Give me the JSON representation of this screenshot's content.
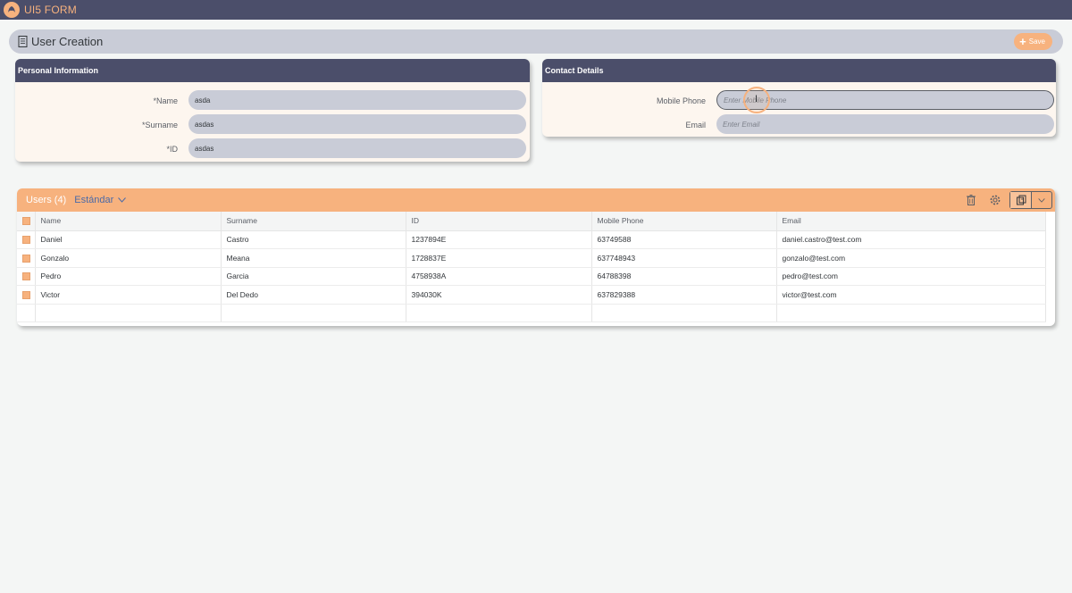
{
  "shell": {
    "title": "UI5 FORM"
  },
  "header": {
    "title": "User Creation",
    "save_label": "Save"
  },
  "personal": {
    "title": "Personal Information",
    "fields": [
      {
        "label": "*Name",
        "value": "asda"
      },
      {
        "label": "*Surname",
        "value": "asdas"
      },
      {
        "label": "*ID",
        "value": "asdas"
      }
    ]
  },
  "contact": {
    "title": "Contact Details",
    "fields": [
      {
        "label": "Mobile Phone",
        "placeholder": "Enter Mobile Phone"
      },
      {
        "label": "Email",
        "placeholder": "Enter Email"
      }
    ]
  },
  "table": {
    "title": "Users (4)",
    "variant": "Estándar",
    "columns": [
      "Name",
      "Surname",
      "ID",
      "Mobile Phone",
      "Email"
    ],
    "rows": [
      [
        "Daniel",
        "Castro",
        "1237894E",
        "63749588",
        "daniel.castro@test.com"
      ],
      [
        "Gonzalo",
        "Meana",
        "1728837E",
        "637748943",
        "gonzalo@test.com"
      ],
      [
        "Pedro",
        "Garcia",
        "4758938A",
        "64788398",
        "pedro@test.com"
      ],
      [
        "Victor",
        "Del Dedo",
        "394030K",
        "637829388",
        "victor@test.com"
      ]
    ],
    "toolbar_icons": [
      "delete-icon",
      "settings-icon",
      "export-icon",
      "chevron-down-icon"
    ]
  },
  "colors": {
    "shell": "#4b4e6a",
    "accent": "#f7b27e",
    "input": "#c9ccd7",
    "link": "#4b6aa7"
  }
}
